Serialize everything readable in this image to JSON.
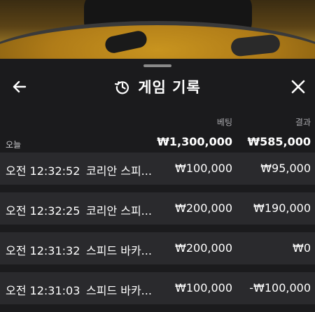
{
  "header": {
    "title": "게임 기록",
    "back_icon": "arrow-left-icon",
    "history_icon": "history-icon",
    "close_icon": "close-icon"
  },
  "columns": {
    "bet": "베팅",
    "result": "결과"
  },
  "summary": {
    "label": "오늘",
    "bet": "₩1,300,000",
    "result": "₩585,000"
  },
  "rows": [
    {
      "time": "오전 12:32:52",
      "game": "코리안 스피...",
      "bet": "₩100,000",
      "result": "₩95,000"
    },
    {
      "time": "오전 12:32:25",
      "game": "코리안 스피...",
      "bet": "₩200,000",
      "result": "₩190,000"
    },
    {
      "time": "오전 12:31:32",
      "game": "스피드 바카...",
      "bet": "₩200,000",
      "result": "₩0"
    },
    {
      "time": "오전 12:31:03",
      "game": "스피드 바카...",
      "bet": "₩100,000",
      "result": "-₩100,000"
    }
  ]
}
